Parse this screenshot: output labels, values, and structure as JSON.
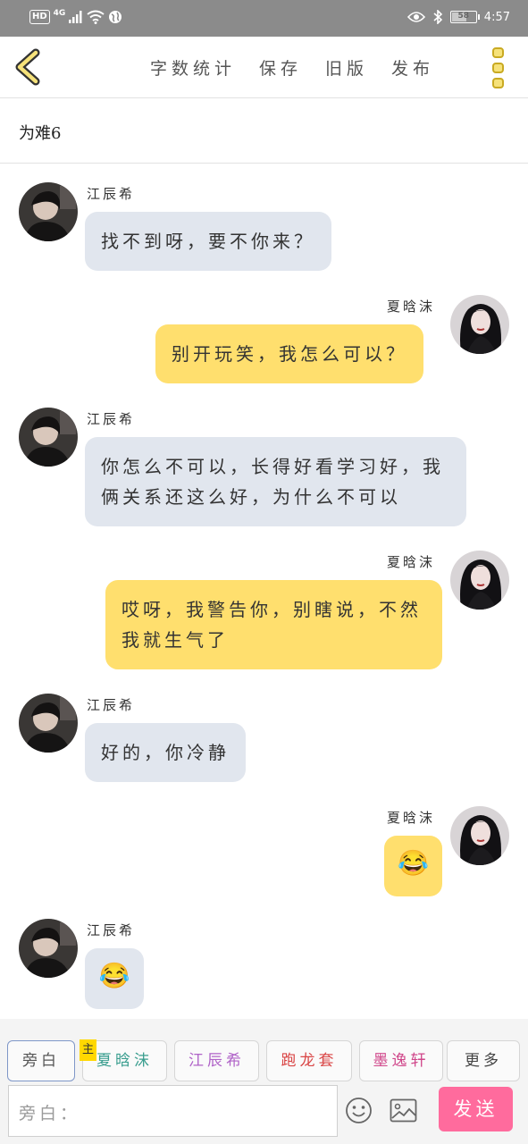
{
  "status_bar": {
    "hd": "HD",
    "network": "4G",
    "battery": "58",
    "time": "4:57"
  },
  "nav": {
    "word_count": "字数统计",
    "save": "保存",
    "old_version": "旧版",
    "publish": "发布"
  },
  "story_title": "为难6",
  "messages": [
    {
      "side": "left",
      "name": "江辰希",
      "text": "找不到呀，要不你来？"
    },
    {
      "side": "right",
      "name": "夏晗沫",
      "text": "别开玩笑，我怎么可以？"
    },
    {
      "side": "left",
      "name": "江辰希",
      "text": "你怎么不可以，长得好看学习好，我俩关系还这么好，为什么不可以"
    },
    {
      "side": "right",
      "name": "夏晗沫",
      "text": "哎呀，我警告你，别瞎说，不然我就生气了"
    },
    {
      "side": "left",
      "name": "江辰希",
      "text": "好的，你冷静"
    },
    {
      "side": "right",
      "name": "夏晗沫",
      "text": "😂"
    },
    {
      "side": "left",
      "name": "江辰希",
      "text": "😂"
    }
  ],
  "roles": [
    {
      "label": "旁白",
      "color": "#555555"
    },
    {
      "label": "夏晗沫",
      "color": "#3a9e8f"
    },
    {
      "label": "江辰希",
      "color": "#b063c8"
    },
    {
      "label": "跑龙套",
      "color": "#d94545"
    },
    {
      "label": "墨逸轩",
      "color": "#d0468a"
    },
    {
      "label": "更多",
      "color": "#444444"
    }
  ],
  "main_tag": "主",
  "input": {
    "placeholder": "旁白："
  },
  "send_label": "发送",
  "colors": {
    "accent_yellow": "#ffdf6e",
    "bubble_gray": "#e1e6ee",
    "send_pink": "#ff6b9d"
  }
}
